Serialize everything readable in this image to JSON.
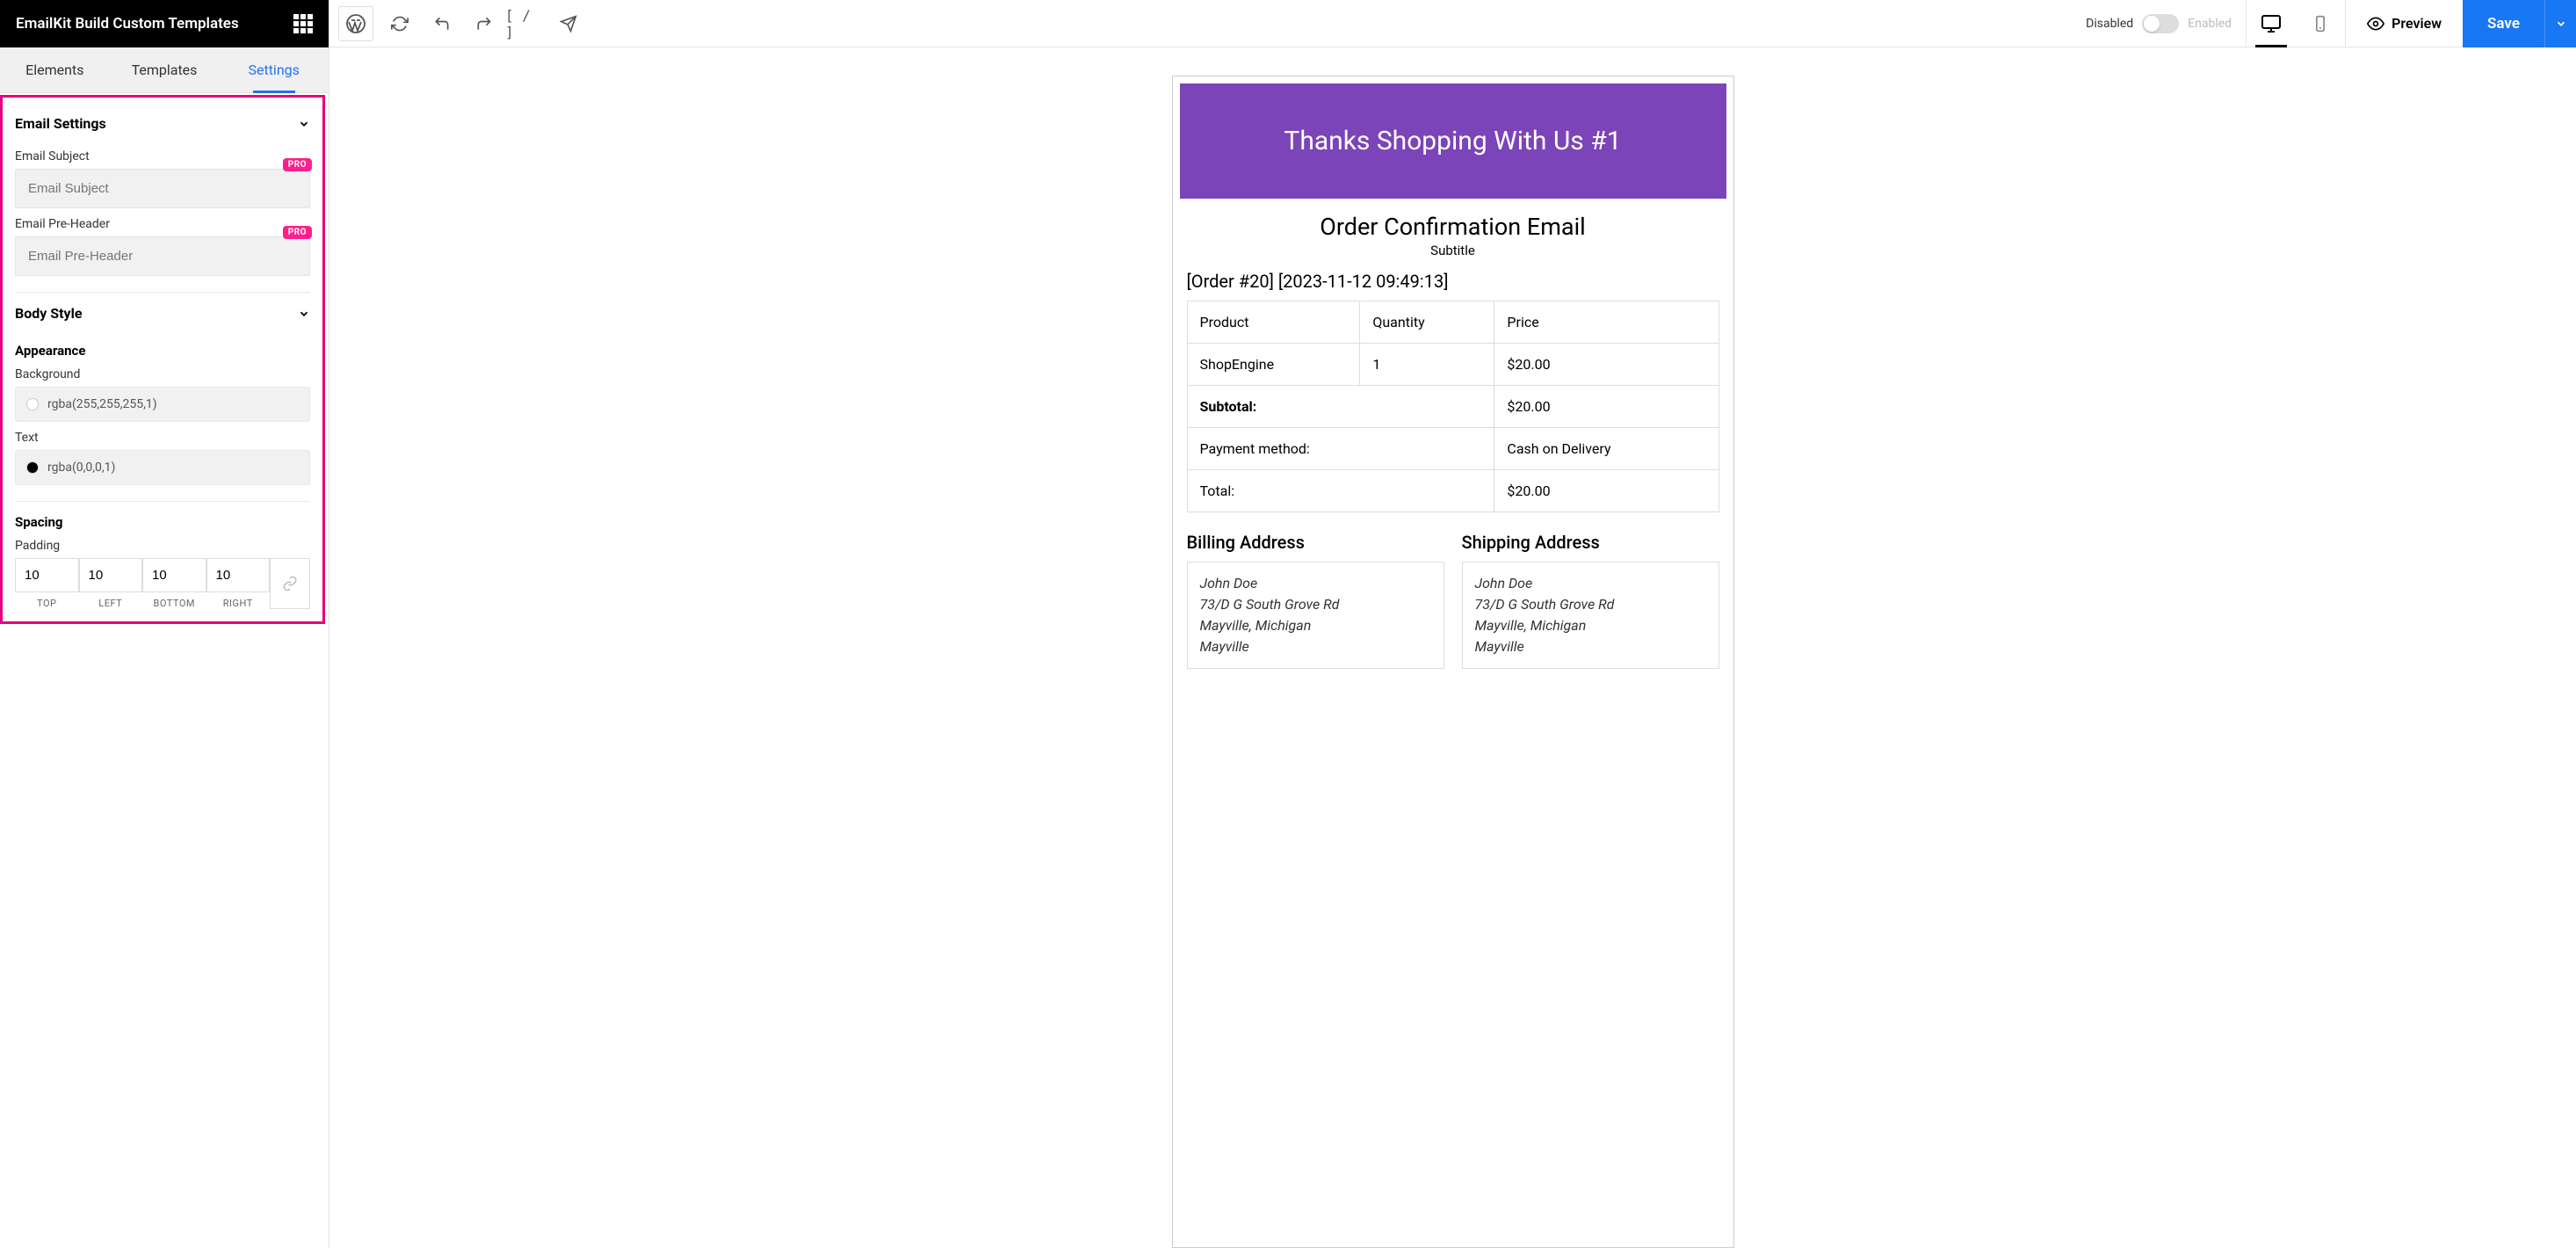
{
  "sidebar": {
    "title": "EmailKit Build Custom Templates",
    "tabs": [
      "Elements",
      "Templates",
      "Settings"
    ],
    "activeTab": 2
  },
  "settings": {
    "emailSection": "Email Settings",
    "subjectLabel": "Email Subject",
    "subjectPlaceholder": "Email Subject",
    "preheaderLabel": "Email Pre-Header",
    "preheaderPlaceholder": "Email Pre-Header",
    "proBadge": "PRO",
    "bodyStyle": "Body Style",
    "appearance": "Appearance",
    "bgLabel": "Background",
    "bgValue": "rgba(255,255,255,1)",
    "bgColor": "#ffffff",
    "textLabel": "Text",
    "textValue": "rgba(0,0,0,1)",
    "textColor": "#000000",
    "spacing": "Spacing",
    "paddingLabel": "Padding",
    "padding": {
      "top": "10",
      "left": "10",
      "bottom": "10",
      "right": "10"
    },
    "padLabels": {
      "top": "TOP",
      "left": "LEFT",
      "bottom": "BOTTOM",
      "right": "RIGHT"
    }
  },
  "topbar": {
    "disabled": "Disabled",
    "enabled": "Enabled",
    "preview": "Preview",
    "save": "Save"
  },
  "email": {
    "heroText": "Thanks Shopping With Us #1",
    "title": "Order Confirmation Email",
    "subtitle": "Subtitle",
    "orderMeta": "[Order #20] [2023-11-12 09:49:13]",
    "headers": {
      "product": "Product",
      "qty": "Quantity",
      "price": "Price"
    },
    "item": {
      "name": "ShopEngine",
      "qty": "1",
      "price": "$20.00"
    },
    "subtotal": {
      "label": "Subtotal:",
      "value": "$20.00"
    },
    "payment": {
      "label": "Payment method:",
      "value": "Cash on Delivery"
    },
    "total": {
      "label": "Total:",
      "value": "$20.00"
    },
    "billingTitle": "Billing Address",
    "shippingTitle": "Shipping Address",
    "address": {
      "name": "John Doe",
      "street": "73/D G South Grove Rd",
      "city": "Mayville, Michigan",
      "locality": "Mayville"
    }
  }
}
